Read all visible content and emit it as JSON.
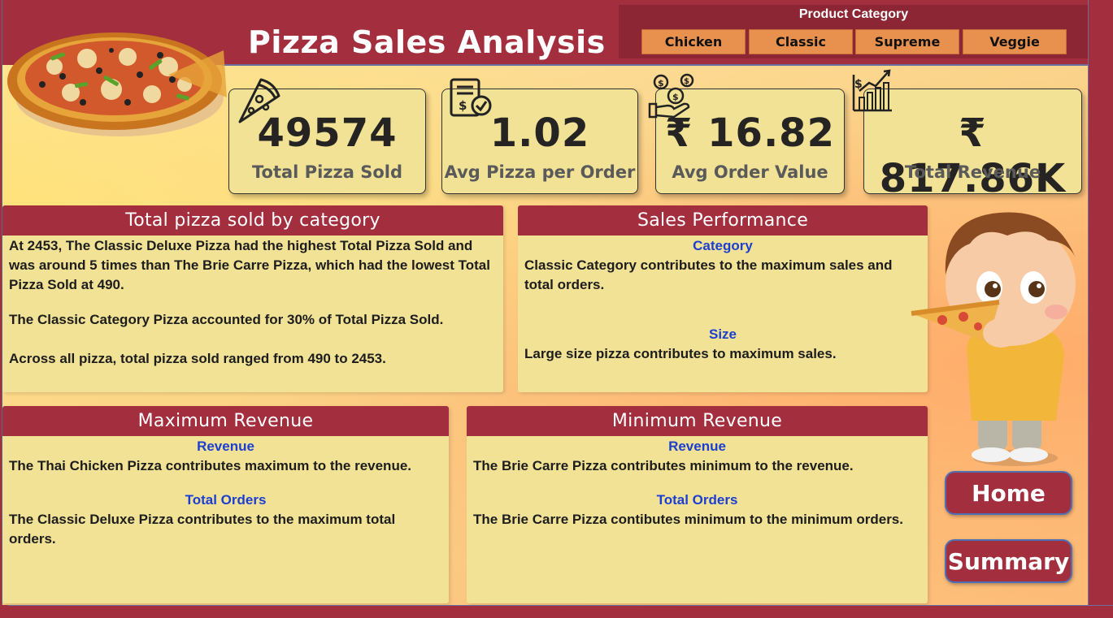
{
  "header": {
    "title": "Pizza Sales Analysis"
  },
  "slicer": {
    "title": "Product Category",
    "options": [
      "Chicken",
      "Classic",
      "Supreme",
      "Veggie"
    ]
  },
  "kpis": [
    {
      "value": "49574",
      "label": "Total Pizza Sold",
      "icon": "pizza-slice-icon"
    },
    {
      "value": "1.02",
      "label": "Avg Pizza per Order",
      "icon": "invoice-check-icon"
    },
    {
      "value": "₹ 16.82",
      "label": "Avg Order Value",
      "icon": "hand-coins-icon"
    },
    {
      "value": "₹ 817.86K",
      "label": "Total Revenue",
      "icon": "growth-chart-icon"
    }
  ],
  "panels": {
    "category": {
      "title": "Total pizza sold by category",
      "lines": [
        "At 2453, The Classic Deluxe Pizza had the highest Total Pizza Sold and was around 5 times than The Brie Carre Pizza, which had the lowest Total Pizza Sold at 490.",
        "The Classic Category Pizza accounted for 30% of Total Pizza Sold.",
        "Across all pizza, total pizza sold ranged from 490 to 2453."
      ]
    },
    "performance": {
      "title": "Sales Performance",
      "sub1": "Category",
      "text1": "Classic Category contributes to the maximum sales and total orders.",
      "sub2": "Size",
      "text2": "Large size pizza contributes to maximum sales."
    },
    "max_revenue": {
      "title": "Maximum Revenue",
      "sub1": "Revenue",
      "text1": "The Thai Chicken Pizza contributes maximum to the revenue.",
      "sub2": "Total Orders",
      "text2": "The Classic Deluxe Pizza contributes to the maximum total orders."
    },
    "min_revenue": {
      "title": "Minimum Revenue",
      "sub1": "Revenue",
      "text1": "The Brie Carre Pizza contributes minimum to the revenue.",
      "sub2": "Total Orders",
      "text2": "The Brie Carre Pizza contibutes minimum to the minimum orders."
    }
  },
  "nav": {
    "home": "Home",
    "summary": "Summary"
  },
  "colors": {
    "brand": "#a32f3e",
    "card": "#f1e296",
    "slicer_button": "#e8914f",
    "subheading": "#1c3fd1"
  }
}
